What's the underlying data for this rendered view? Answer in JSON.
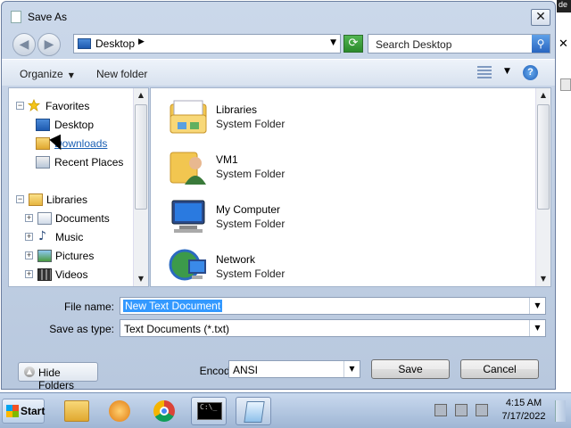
{
  "dialog": {
    "title": "Save As",
    "close_glyph": "✕"
  },
  "background": {
    "edge_text": "de",
    "close_glyph": "✕"
  },
  "address": {
    "back_glyph": "◀",
    "forward_glyph": "▶",
    "location": "Desktop",
    "chevron_glyph": "▶",
    "dropdown_glyph": "▼",
    "refresh_glyph": "⟳",
    "search_placeholder": "Search Desktop",
    "search_glyph": "⚲"
  },
  "toolbar": {
    "organize": "Organize",
    "organize_chevron": "▼",
    "new_folder": "New folder",
    "view_chevron": "▼",
    "help_glyph": "?"
  },
  "nav": {
    "favorites_label": "Favorites",
    "favorites": [
      {
        "label": "Desktop",
        "icon": "desktop-icon"
      },
      {
        "label": "Downloads",
        "icon": "downloads-folder-icon"
      },
      {
        "label": "Recent Places",
        "icon": "recent-places-icon"
      }
    ],
    "libraries_label": "Libraries",
    "libraries": [
      {
        "label": "Documents",
        "icon": "documents-icon"
      },
      {
        "label": "Music",
        "icon": "music-icon"
      },
      {
        "label": "Pictures",
        "icon": "pictures-icon"
      },
      {
        "label": "Videos",
        "icon": "videos-icon"
      }
    ],
    "expand_glyph": "+",
    "collapse_glyph": "−"
  },
  "files": [
    {
      "name": "Libraries",
      "type": "System Folder",
      "icon": "libraries-folder-icon"
    },
    {
      "name": "VM1",
      "type": "System Folder",
      "icon": "user-folder-icon"
    },
    {
      "name": "My Computer",
      "type": "System Folder",
      "icon": "computer-icon"
    },
    {
      "name": "Network",
      "type": "System Folder",
      "icon": "network-icon"
    }
  ],
  "scroll_glyphs": {
    "up": "▲",
    "down": "▼"
  },
  "form": {
    "file_name_label": "File name:",
    "file_name_value": "New Text Document",
    "save_type_label": "Save as type:",
    "save_type_value": "Text Documents (*.txt)",
    "encoding_label": "Encoding:",
    "encoding_value": "ANSI",
    "dropdown_glyph": "▼",
    "hide_folders": "Hide Folders",
    "hide_glyph": "▲",
    "save": "Save",
    "cancel": "Cancel"
  },
  "taskbar": {
    "start": "Start",
    "time": "4:15 AM",
    "date": "7/17/2022",
    "cmd_text": "C:\\_"
  },
  "colors": {
    "selection": "#3399ff",
    "window_frame": "#b8c8de",
    "taskbar": "#9fb6d4"
  }
}
